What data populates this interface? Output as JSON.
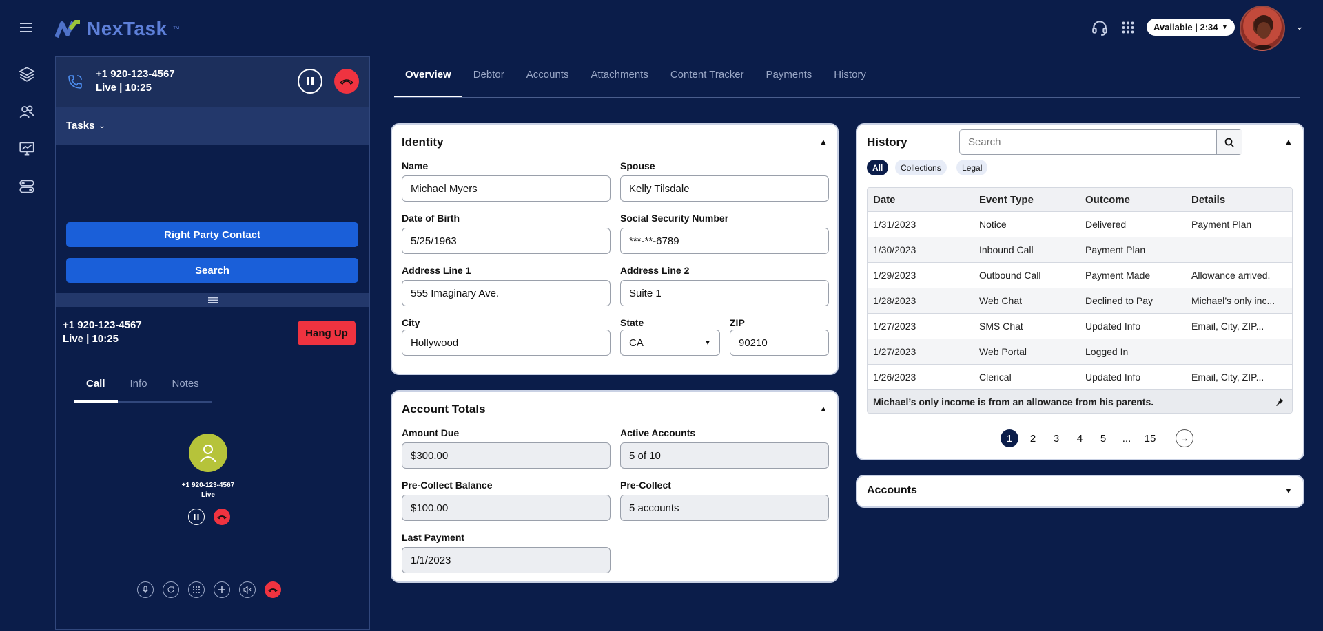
{
  "app": {
    "name": "NexTask",
    "tm": "™"
  },
  "header": {
    "status_label": "Available | 2:34"
  },
  "active_call": {
    "number": "+1 920-123-4567",
    "status": "Live | 10:25"
  },
  "tasks": {
    "label": "Tasks",
    "right_party_label": "Right Party Contact",
    "search_label": "Search"
  },
  "call_panel": {
    "number": "+1 920-123-4567",
    "status": "Live | 10:25",
    "hangup_label": "Hang Up",
    "tabs": [
      "Call",
      "Info",
      "Notes"
    ],
    "contact_number": "+1 920-123-4567",
    "contact_status": "Live"
  },
  "main_tabs": [
    "Overview",
    "Debtor",
    "Accounts",
    "Attachments",
    "Content Tracker",
    "Payments",
    "History"
  ],
  "identity": {
    "title": "Identity",
    "name_label": "Name",
    "name": "Michael Myers",
    "spouse_label": "Spouse",
    "spouse": "Kelly Tilsdale",
    "dob_label": "Date of Birth",
    "dob": "5/25/1963",
    "ssn_label": "Social Security Number",
    "ssn": "***-**-6789",
    "addr1_label": "Address Line 1",
    "addr1": "555 Imaginary Ave.",
    "addr2_label": "Address Line 2",
    "addr2": "Suite 1",
    "city_label": "City",
    "city": "Hollywood",
    "state_label": "State",
    "state": "CA",
    "zip_label": "ZIP",
    "zip": "90210"
  },
  "totals": {
    "title": "Account Totals",
    "amount_due_label": "Amount Due",
    "amount_due": "$300.00",
    "active_accounts_label": "Active Accounts",
    "active_accounts": "5 of 10",
    "precollect_balance_label": "Pre-Collect Balance",
    "precollect_balance": "$100.00",
    "precollect_label": "Pre-Collect",
    "precollect": "5 accounts",
    "last_payment_label": "Last Payment",
    "last_payment": "1/1/2023"
  },
  "history": {
    "title": "History",
    "search_placeholder": "Search",
    "filters": [
      "All",
      "Collections",
      "Legal"
    ],
    "columns": [
      "Date",
      "Event Type",
      "Outcome",
      "Details"
    ],
    "rows": [
      [
        "1/31/2023",
        "Notice",
        "Delivered",
        "Payment Plan"
      ],
      [
        "1/30/2023",
        "Inbound Call",
        "Payment Plan",
        ""
      ],
      [
        "1/29/2023",
        "Outbound Call",
        "Payment Made",
        "Allowance arrived."
      ],
      [
        "1/28/2023",
        "Web Chat",
        "Declined to Pay",
        "Michael’s only inc..."
      ],
      [
        "1/27/2023",
        "SMS Chat",
        "Updated Info",
        "Email, City, ZIP..."
      ],
      [
        "1/27/2023",
        "Web Portal",
        "Logged In",
        ""
      ],
      [
        "1/26/2023",
        "Clerical",
        "Updated Info",
        "Email, City, ZIP..."
      ]
    ],
    "pinned_note": "Michael’s only income is from an allowance from his parents.",
    "pages": [
      "1",
      "2",
      "3",
      "4",
      "5",
      "...",
      "15"
    ]
  },
  "accounts": {
    "title": "Accounts"
  },
  "colors": {
    "navy": "#0b1d4a",
    "accent_blue": "#1a5fd9",
    "danger": "#ef3340",
    "avatar_green": "#b6c33a"
  }
}
